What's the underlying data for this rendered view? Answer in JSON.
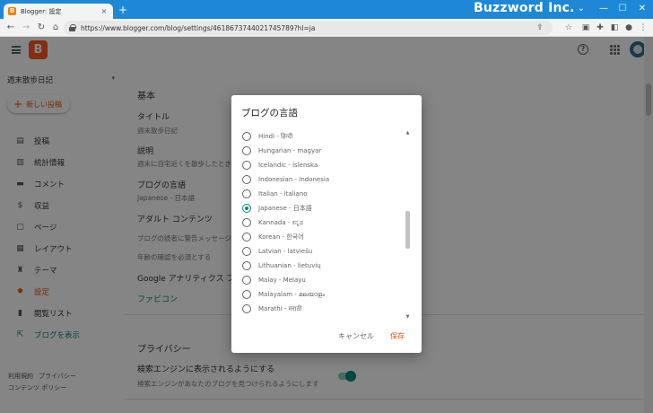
{
  "browser": {
    "tab_title": "Blogger: 設定",
    "tab_favicon": "B",
    "tab_close": "×",
    "new_tab": "+",
    "url": "https://www.blogger.com/blog/settings/4618673744021745789?hl=ja",
    "watermark": "Buzzword Inc.",
    "window_controls": [
      "⌄",
      "—",
      "☐",
      "✕"
    ]
  },
  "app": {
    "logo": "B",
    "help_icon_glyph": "?",
    "blog_name": "週末散歩日記",
    "new_post_label": "新しい投稿",
    "sidebar": [
      {
        "icon": "list-icon",
        "glyph": "▤",
        "label": "投稿"
      },
      {
        "icon": "stats-icon",
        "glyph": "▥",
        "label": "統計情報"
      },
      {
        "icon": "comment-icon",
        "glyph": "▬",
        "label": "コメント"
      },
      {
        "icon": "dollar-icon",
        "glyph": "$",
        "label": "収益"
      },
      {
        "icon": "pages-icon",
        "glyph": "▢",
        "label": "ページ"
      },
      {
        "icon": "layout-icon",
        "glyph": "▦",
        "label": "レイアウト"
      },
      {
        "icon": "theme-icon",
        "glyph": "♜",
        "label": "テーマ"
      },
      {
        "icon": "gear-icon",
        "glyph": "✹",
        "label": "設定"
      },
      {
        "icon": "bookmark-icon",
        "glyph": "▮",
        "label": "閲覧リスト"
      },
      {
        "icon": "open-external-icon",
        "glyph": "⇱",
        "label": "ブログを表示"
      }
    ],
    "footer": [
      "利用規約",
      "プライバシー",
      "コンテンツ ポリシー"
    ]
  },
  "settings": {
    "basic_title": "基本",
    "title_label": "タイトル",
    "title_value": "週末散歩日記",
    "description_label": "説明",
    "description_value": "週末に自宅近くを散歩したときの",
    "language_label": "ブログの言語",
    "language_value": "Japanese - 日本語",
    "adult_label": "アダルト コンテンツ",
    "adult_value": "ブログの読者に警告メッセージを",
    "adult_value2": "年齢の確認を必須とする",
    "analytics_label": "Google アナリティクス プロパ",
    "favicon_label": "ファビコン",
    "privacy_title": "プライバシー",
    "search_label": "検索エンジンに表示されるようにする",
    "search_value": "検索エンジンがあなたのブログを見つけられるようにします"
  },
  "dialog": {
    "title": "ブログの言語",
    "languages": [
      {
        "label": "Hindi - हिन्दी",
        "checked": false
      },
      {
        "label": "Hungarian - magyar",
        "checked": false
      },
      {
        "label": "Icelandic - íslenska",
        "checked": false
      },
      {
        "label": "Indonesian - Indonesia",
        "checked": false
      },
      {
        "label": "Italian - italiano",
        "checked": false
      },
      {
        "label": "Japanese - 日本語",
        "checked": true
      },
      {
        "label": "Kannada - ಕನ್ನಡ",
        "checked": false
      },
      {
        "label": "Korean - 한국어",
        "checked": false
      },
      {
        "label": "Latvian - latviešu",
        "checked": false
      },
      {
        "label": "Lithuanian - lietuvių",
        "checked": false
      },
      {
        "label": "Malay - Melayu",
        "checked": false
      },
      {
        "label": "Malayalam - മലയാളം",
        "checked": false
      },
      {
        "label": "Marathi - मराठी",
        "checked": false
      }
    ],
    "cancel_label": "キャンセル",
    "save_label": "保存"
  }
}
